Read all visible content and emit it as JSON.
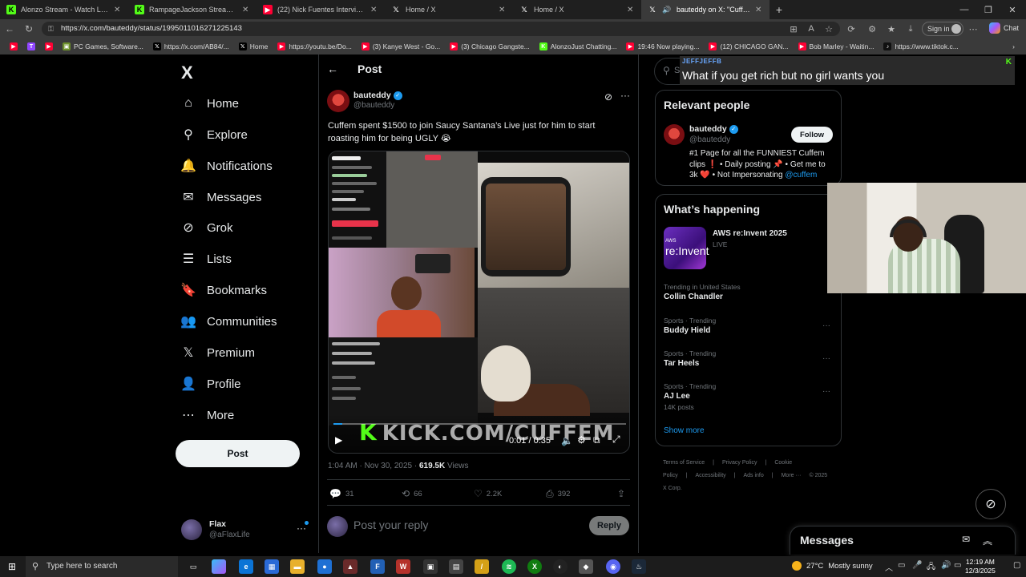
{
  "browser": {
    "tabs": [
      {
        "title": "Alonzo Stream - Watch Live on Kick",
        "favicon": "kick-icon",
        "color": "#53fc18"
      },
      {
        "title": "RampageJackson Stream - Watch Live",
        "favicon": "kick-icon",
        "color": "#53fc18"
      },
      {
        "title": "(22) Nick Fuentes Interview: on W...",
        "favicon": "youtube-icon",
        "color": "#ff0033"
      },
      {
        "title": "Home / X",
        "favicon": "x-icon",
        "color": "#000000"
      },
      {
        "title": "Home / X",
        "favicon": "x-icon",
        "color": "#000000"
      },
      {
        "title": "bauteddy on X: \"Cuffem spent ...",
        "favicon": "x-icon",
        "color": "#000000"
      }
    ],
    "url": "https://x.com/bauteddy/status/1995011016271225143",
    "signin_label": "Sign in",
    "chat_label": "Chat",
    "bookmarks": [
      {
        "label": "",
        "icon": "youtube-icon",
        "color": "#ff0033"
      },
      {
        "label": "",
        "icon": "twitch-icon",
        "color": "#9146ff"
      },
      {
        "label": "",
        "icon": "youtube-icon",
        "color": "#ff0033"
      },
      {
        "label": "PC Games, Software...",
        "icon": "pc-icon",
        "color": "#6c8f2b"
      },
      {
        "label": "https://x.com/AB84/...",
        "icon": "x-icon",
        "color": "#000000"
      },
      {
        "label": "Home",
        "icon": "x-icon",
        "color": "#000000"
      },
      {
        "label": "https://youtu.be/Do...",
        "icon": "youtube-icon",
        "color": "#ff0033"
      },
      {
        "label": "(3) Kanye West - Go...",
        "icon": "youtube-icon",
        "color": "#ff0033"
      },
      {
        "label": "(3) Chicago Gangste...",
        "icon": "youtube-icon",
        "color": "#ff0033"
      },
      {
        "label": "AlonzoJust Chatting...",
        "icon": "kick-icon",
        "color": "#53fc18"
      },
      {
        "label": "19:46 Now playing...",
        "icon": "youtube-icon",
        "color": "#ff0033"
      },
      {
        "label": "(12) CHICAGO GAN...",
        "icon": "youtube-icon",
        "color": "#ff0033"
      },
      {
        "label": "Bob Marley - Waitin...",
        "icon": "youtube-icon",
        "color": "#ff0033"
      },
      {
        "label": "https://www.tiktok.c...",
        "icon": "tiktok-icon",
        "color": "#111111"
      }
    ]
  },
  "nav": {
    "logo": "X",
    "items": [
      {
        "label": "Home",
        "icon": "home-icon",
        "glyph": "⌂"
      },
      {
        "label": "Explore",
        "icon": "search-icon",
        "glyph": "⚲"
      },
      {
        "label": "Notifications",
        "icon": "bell-icon",
        "glyph": "🔔"
      },
      {
        "label": "Messages",
        "icon": "envelope-icon",
        "glyph": "✉"
      },
      {
        "label": "Grok",
        "icon": "grok-icon",
        "glyph": "⊘"
      },
      {
        "label": "Lists",
        "icon": "list-icon",
        "glyph": "☰"
      },
      {
        "label": "Bookmarks",
        "icon": "bookmark-icon",
        "glyph": "🔖"
      },
      {
        "label": "Communities",
        "icon": "people-icon",
        "glyph": "👥"
      },
      {
        "label": "Premium",
        "icon": "x-premium-icon",
        "glyph": "𝕏"
      },
      {
        "label": "Profile",
        "icon": "person-icon",
        "glyph": "👤"
      },
      {
        "label": "More",
        "icon": "more-circle-icon",
        "glyph": "⋯"
      }
    ],
    "post_label": "Post",
    "account": {
      "name": "Flax",
      "handle": "@aFlaxLife"
    }
  },
  "post": {
    "header": "Post",
    "author_name": "bauteddy",
    "author_handle": "@bauteddy",
    "text": "Cuffem spent $1500 to join Saucy Santana’s Live just for him to start roasting him for being UGLY 😭",
    "video": {
      "watermark": "KICK.COM/CUFFEM",
      "time": "0:01 / 0:35",
      "progress": 0.029
    },
    "meta_time": "1:04 AM · Nov 30, 2025 · ",
    "meta_views": "619.5K",
    "meta_views_label": " Views",
    "stats": {
      "replies": "31",
      "reposts": "66",
      "likes": "2.2K",
      "bookmarks": "392"
    },
    "reply_placeholder": "Post your reply",
    "reply_button": "Reply"
  },
  "right": {
    "search_placeholder": "Search",
    "overlay_small": "JEFFJEFFB",
    "overlay_big": "What if you get rich but no girl wants you",
    "relevant_title": "Relevant people",
    "relevant": {
      "name": "bauteddy",
      "handle": "@bauteddy",
      "follow": "Follow",
      "bio": "#1 Page for all the FUNNIEST Cuffem clips ❗ • Daily posting 📌 • Get me to 3k ❤️ • Not Impersonating ",
      "bio_link": "@cuffem"
    },
    "happening_title": "What’s happening",
    "event": {
      "title": "AWS re:Invent 2025",
      "sub": "LIVE",
      "img_small": "AWS",
      "img_big": "re:Invent"
    },
    "trends": [
      {
        "context": "Trending in United States",
        "title": "Collin Chandler",
        "posts": ""
      },
      {
        "context": "Sports · Trending",
        "title": "Buddy Hield",
        "posts": ""
      },
      {
        "context": "Sports · Trending",
        "title": "Tar Heels",
        "posts": ""
      },
      {
        "context": "Sports · Trending",
        "title": "AJ Lee",
        "posts": "14K posts"
      }
    ],
    "show_more": "Show more",
    "footer": [
      "Terms of Service",
      "|",
      "Privacy Policy",
      "|",
      "Cookie Policy",
      "|",
      "Accessibility",
      "|",
      "Ads info",
      "|",
      "More ···",
      "© 2025 X Corp."
    ],
    "messages_title": "Messages"
  },
  "taskbar": {
    "search_placeholder": "Type here to search",
    "weather_temp": "27°C",
    "weather_text": "Mostly sunny",
    "time": "12:19 AM",
    "date": "12/3/2025"
  },
  "colors": {
    "accent": "#1d9bf0",
    "kick": "#53fc18",
    "bg": "#000000",
    "border": "#2f3336"
  }
}
